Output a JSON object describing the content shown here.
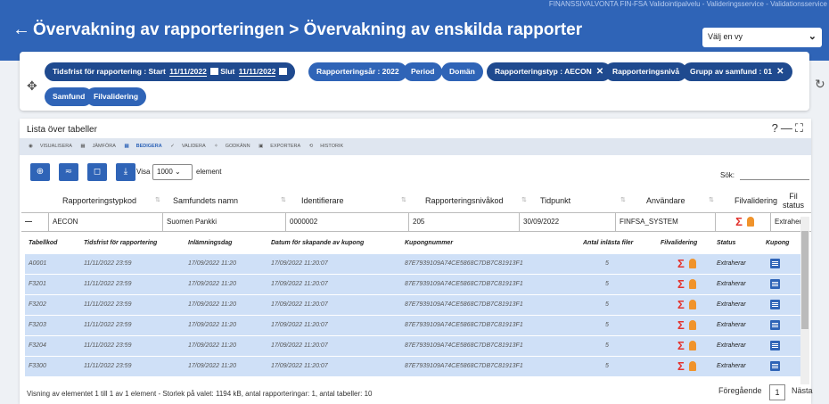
{
  "header": {
    "system_line": "FINANSSIVALVONTA FIN-FSA Validointipalvelu - Valideringsservice - Validationsservice",
    "title": "Övervakning av rapporteringen > Övervakning av enskilda rapporter",
    "view_select": "Välj en vy"
  },
  "filters": {
    "deadline_label": "Tidsfrist för rapportering : Start",
    "start_date": "11/11/2022",
    "end_label": "Slut",
    "end_date": "11/11/2022",
    "year": "Rapporteringsår : 2022",
    "period": "Period",
    "domain": "Domän",
    "report_type": "Rapporteringstyp : AECON",
    "level": "Rapporteringsnivå",
    "group": "Grupp av samfund : 01",
    "entity": "Samfund",
    "file_validation": "Filvalidering"
  },
  "panel": {
    "title": "Lista över tabeller",
    "toolbar": {
      "visualize": "VISUALISERA",
      "compare": "JÄMFÖRA",
      "edit": "BEDIGERA",
      "validate": "VALIDERA",
      "approve": "GODKÄNN",
      "export": "EXPORTERA",
      "history": "HISTORIK"
    },
    "show_label": "Visa",
    "show_count": "1000",
    "elements_label": "element",
    "search_label": "Sök:"
  },
  "columns": [
    "Rapporteringstypkod",
    "Samfundets namn",
    "Identifierare",
    "Rapporteringsnivåkod",
    "Tidpunkt",
    "Användare",
    "Filvalidering",
    "Fil status"
  ],
  "group_row": {
    "type": "AECON",
    "name": "Suomen Pankki",
    "id": "0000002",
    "level": "205",
    "time": "30/09/2022",
    "user": "FINFSA_SYSTEM",
    "status": "Extraherar"
  },
  "sub_columns": [
    "Tabellkod",
    "Tidsfrist för rapportering",
    "Inlämningsdag",
    "Datum för skapande av kupong",
    "Kupongnummer",
    "Antal inlästa filer",
    "Filvalidering",
    "Status",
    "Kupong"
  ],
  "rows": [
    {
      "code": "A0001",
      "deadline": "11/11/2022 23:59",
      "submitted": "17/09/2022 11:20",
      "created": "17/09/2022 11:20:07",
      "coupon": "87E7939109A74CE5868C7DB7C81913F1",
      "files": "5",
      "status": "Extraherar"
    },
    {
      "code": "F3201",
      "deadline": "11/11/2022 23:59",
      "submitted": "17/09/2022 11:20",
      "created": "17/09/2022 11:20:07",
      "coupon": "87E7939109A74CE5868C7DB7C81913F1",
      "files": "5",
      "status": "Extraherar"
    },
    {
      "code": "F3202",
      "deadline": "11/11/2022 23:59",
      "submitted": "17/09/2022 11:20",
      "created": "17/09/2022 11:20:07",
      "coupon": "87E7939109A74CE5868C7DB7C81913F1",
      "files": "5",
      "status": "Extraherar"
    },
    {
      "code": "F3203",
      "deadline": "11/11/2022 23:59",
      "submitted": "17/09/2022 11:20",
      "created": "17/09/2022 11:20:07",
      "coupon": "87E7939109A74CE5868C7DB7C81913F1",
      "files": "5",
      "status": "Extraherar"
    },
    {
      "code": "F3204",
      "deadline": "11/11/2022 23:59",
      "submitted": "17/09/2022 11:20",
      "created": "17/09/2022 11:20:07",
      "coupon": "87E7939109A74CE5868C7DB7C81913F1",
      "files": "5",
      "status": "Extraherar"
    },
    {
      "code": "F3300",
      "deadline": "11/11/2022 23:59",
      "submitted": "17/09/2022 11:20",
      "created": "17/09/2022 11:20:07",
      "coupon": "87E7939109A74CE5868C7DB7C81913F1",
      "files": "5",
      "status": "Extraherar"
    }
  ],
  "footer": {
    "summary": "Visning av elementet 1 till 1 av 1 element - Storlek på valet: 1194 kB, antal rapporteringar: 1, antal tabeller: 10",
    "prev": "Föregående",
    "page": "1",
    "next": "Nästa"
  },
  "colors": {
    "accent": "#2f64b7",
    "row_bg": "#cfe0f7",
    "sigma": "#e3342f",
    "user_icon": "#f0932b"
  },
  "icons": [
    "back-arrow-icon",
    "pencil-icon",
    "chevron-down-icon",
    "move-icon",
    "refresh-icon",
    "calendar-icon",
    "close-icon",
    "help-icon",
    "minimize-icon",
    "fullscreen-icon",
    "eye-icon",
    "sigma-icon",
    "user-icon",
    "document-icon"
  ]
}
